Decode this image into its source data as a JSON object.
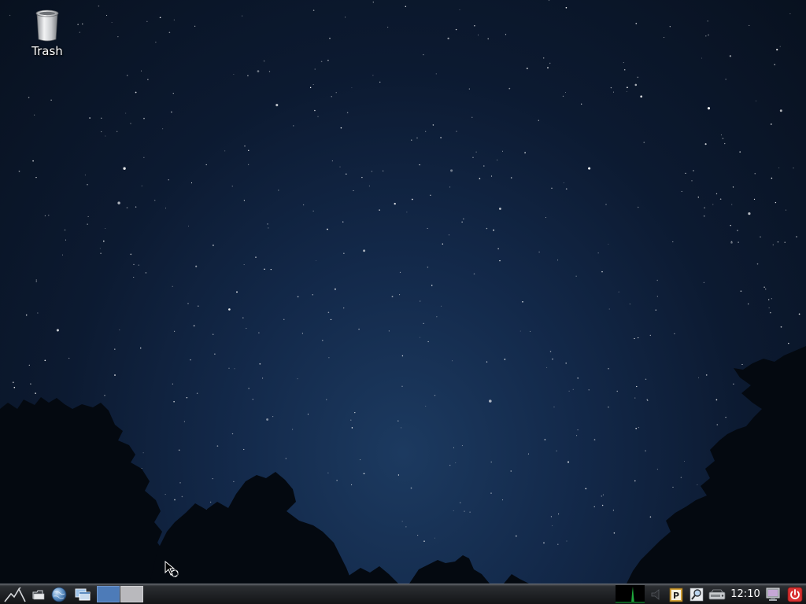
{
  "desktop": {
    "trash_label": "Trash"
  },
  "taskbar": {
    "clock": "12:10"
  },
  "icons": [
    "menu-icon",
    "file-manager-icon",
    "web-browser-icon",
    "show-desktop-icon",
    "workspace-1",
    "workspace-2",
    "cpu-monitor-icon",
    "volume-icon",
    "clipboard-icon",
    "search-icon",
    "network-icon",
    "screen-lock-icon",
    "power-icon"
  ],
  "colors": {
    "sky_top": "#08111f",
    "sky_glow": "#1c3a60",
    "workspace_active": "#4d7bb8",
    "workspace_inactive": "#b9b9bd",
    "power_button": "#d93232",
    "cpu_graph": "#1ea83c"
  }
}
